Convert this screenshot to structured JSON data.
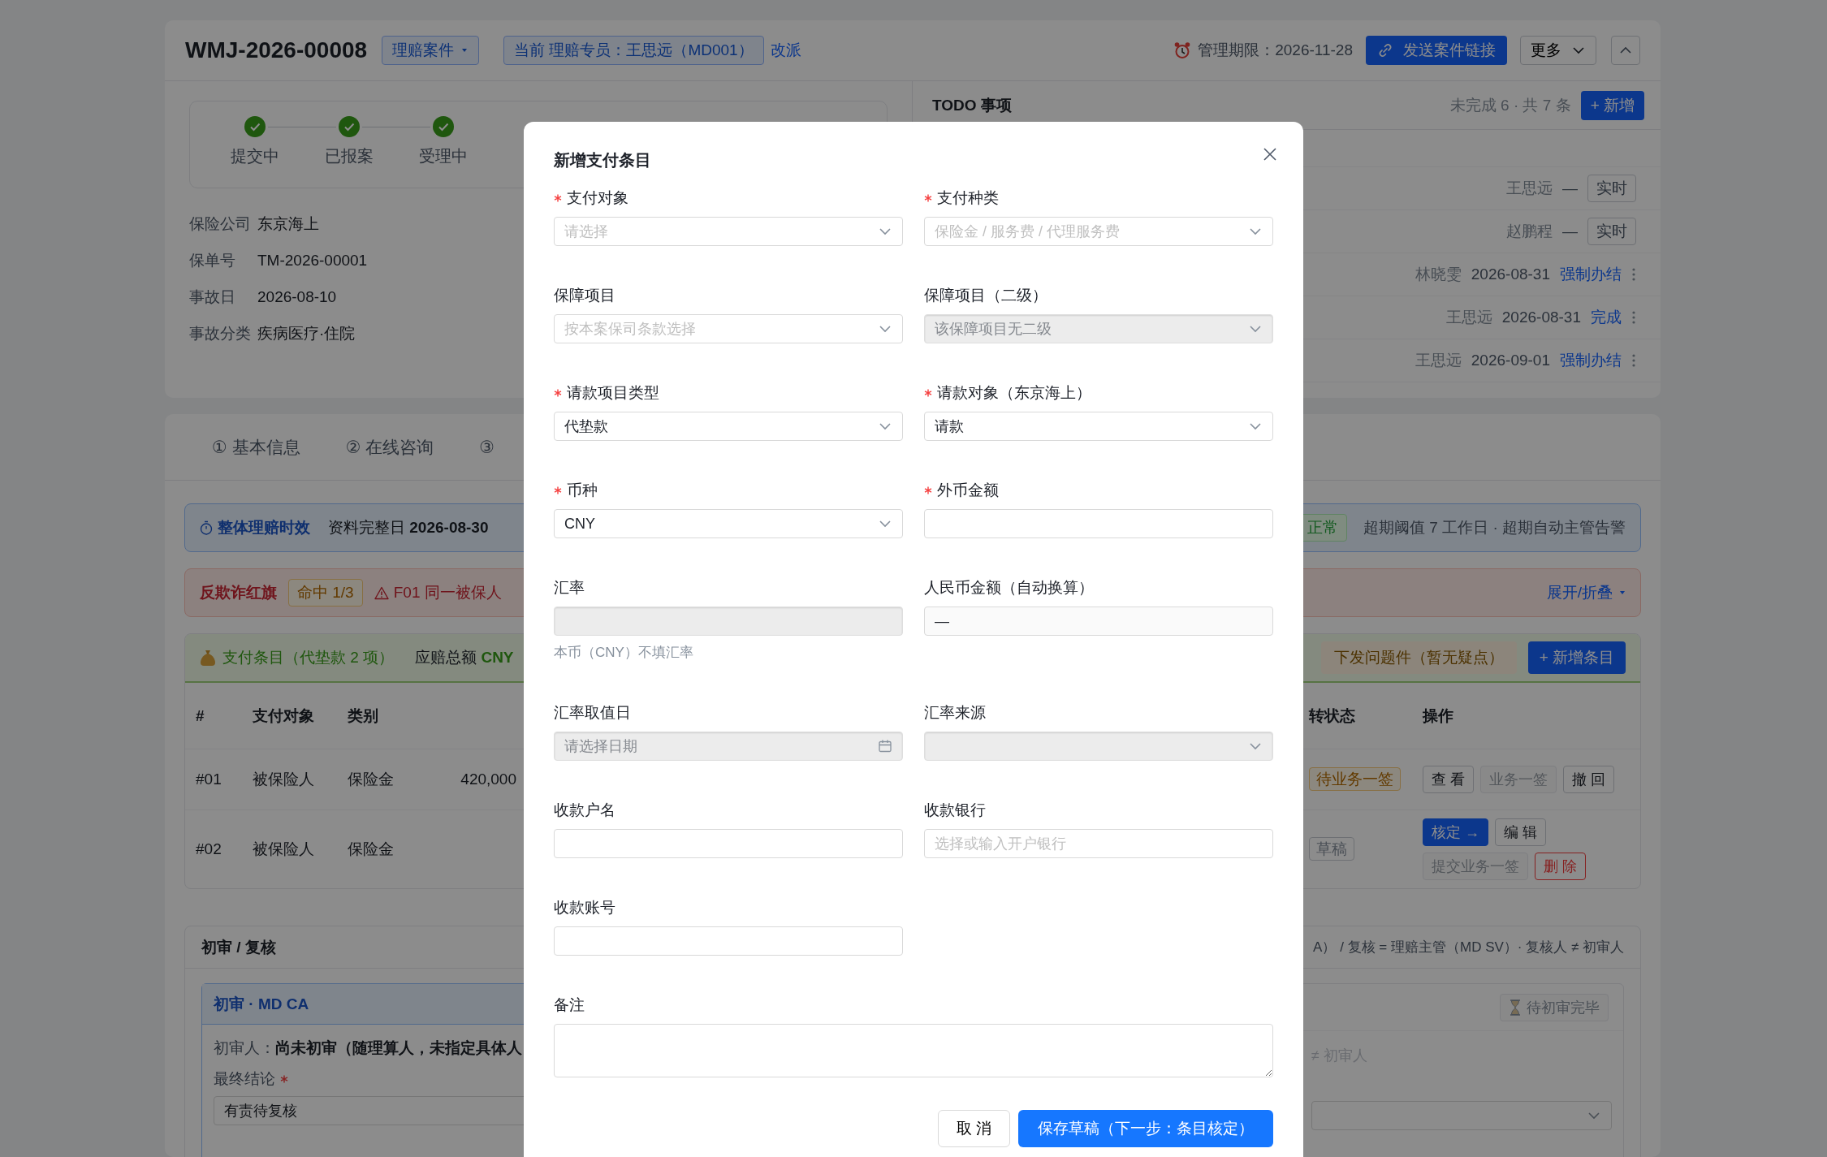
{
  "header": {
    "case_no": "WMJ-2026-00008",
    "case_type": "理赔案件",
    "assignee": "当前 理赔专员：王思远（MD001）",
    "reassign_link": "改派",
    "deadline": "管理期限：2026-11-28",
    "send_link_button": "发送案件链接",
    "more_button": "更多"
  },
  "progress_steps": [
    {
      "label": "提交中",
      "kind": "done"
    },
    {
      "label": "已报案",
      "kind": "done"
    },
    {
      "label": "受理中",
      "kind": "done"
    }
  ],
  "case_info": [
    {
      "label": "保险公司",
      "value": "东京海上"
    },
    {
      "label": "保单号",
      "value": "TM-2026-00001"
    },
    {
      "label": "事故日",
      "value": "2026-08-10"
    },
    {
      "label": "事故分类",
      "value": "疾病医疗·住院"
    }
  ],
  "todo": {
    "title": "TODO 事项",
    "summary": "未完成 6 · 共 7 条",
    "add_button": "+ 新增",
    "items": [
      {
        "assignee": "王思远",
        "due": "—",
        "action": "实时",
        "kind": "tag"
      },
      {
        "assignee": "赵鹏程",
        "due": "—",
        "action": "实时",
        "kind": "tag"
      },
      {
        "assignee": "林晓雯",
        "due": "2026-08-31",
        "action": "强制办结",
        "kind": "link"
      },
      {
        "assignee": "王思远",
        "due": "2026-08-31",
        "action": "完成",
        "kind": "link"
      },
      {
        "assignee": "王思远",
        "due": "2026-09-01",
        "action": "强制办结",
        "kind": "link"
      }
    ]
  },
  "tabs": [
    {
      "label": "① 基本信息",
      "selected": false
    },
    {
      "label": "② 在线咨询",
      "selected": false
    },
    {
      "label": "③",
      "selected": false
    }
  ],
  "sla_banner": {
    "title": "整体理赔时效",
    "complete_date": "资料完整日 **2026-08-30**",
    "status": "正常",
    "note": "超期阈值 7 工作日 · 超期自动主管告警"
  },
  "fraud_banner": {
    "title": "反欺诈红旗",
    "hits": "命中 1/3",
    "first_flag": "F01 同一被保人",
    "toggle": "展开/折叠"
  },
  "payments": {
    "title": "支付条目（代垫款 2 项）",
    "total": "应赔总额 **CNY**",
    "issue_button": "下发问题件（暂无疑点）",
    "add_button": "+ 新增条目",
    "columns": [
      "#",
      "支付对象",
      "类别",
      "转状态",
      "操作"
    ],
    "rows": [
      {
        "no": "#01",
        "payee": "被保险人",
        "category": "保险金",
        "amount": "420,000",
        "status": "待业务一签",
        "kind": "pending",
        "actions": [
          {
            "label": "查 看",
            "kind": "default"
          },
          {
            "label": "业务一签",
            "kind": "disabled"
          },
          {
            "label": "撤 回",
            "kind": "default"
          }
        ]
      },
      {
        "no": "#02",
        "payee": "被保险人",
        "category": "保险金",
        "status": "草稿",
        "kind": "draft",
        "actions": [
          {
            "label": "核定 →",
            "kind": "primary"
          },
          {
            "label": "编 辑",
            "kind": "default"
          },
          {
            "label": "提交业务一签",
            "kind": "disabled"
          },
          {
            "label": "删 除",
            "kind": "danger"
          }
        ]
      }
    ]
  },
  "review": {
    "title": "初审 / 复核",
    "rule": "A） / 复核 = 理赔主管（MD SV）· 复核人 ≠ 初审人",
    "first_review": {
      "title": "初审 · MD CA",
      "reviewer": "初审人：**尚未初审（随理算人，未指定具体人**",
      "conclusion_label": "最终结论",
      "conclusion_required": true,
      "conclusion": "有责待复核"
    },
    "second_review": {
      "status_button": "待初审完毕",
      "note": "≠ 初审人"
    }
  },
  "modal": {
    "title": "新增支付条目",
    "cancel_button": "取 消",
    "save_button": "保存草稿（下一步：条目核定）",
    "fields": [
      {
        "label": "支付对象",
        "required": true,
        "kind": "select",
        "placeholder": "请选择",
        "disabled": false
      },
      {
        "label": "支付种类",
        "required": true,
        "kind": "select",
        "placeholder": "保险金 / 服务费 / 代理服务费",
        "disabled": false
      },
      {
        "label": "保障项目",
        "required": false,
        "kind": "select",
        "placeholder": "按本案保司条款选择",
        "disabled": false
      },
      {
        "label": "保障项目（二级）",
        "required": false,
        "kind": "select",
        "placeholder": "该保障项目无二级",
        "disabled": true
      },
      {
        "label": "请款项目类型",
        "required": true,
        "kind": "select",
        "value": "代垫款",
        "disabled": false
      },
      {
        "label": "请款对象（东京海上）",
        "required": true,
        "kind": "select",
        "value": "请款",
        "disabled": false
      },
      {
        "label": "币种",
        "required": true,
        "kind": "select",
        "value": "CNY",
        "disabled": false
      },
      {
        "label": "外币金额",
        "required": true,
        "kind": "input",
        "disabled": false
      },
      {
        "label": "汇率",
        "required": false,
        "kind": "input",
        "disabled": true,
        "hint": "本币（CNY）不填汇率"
      },
      {
        "label": "人民币金额（自动换算）",
        "required": false,
        "kind": "input",
        "value": "—",
        "disabled": false,
        "readonly": true
      },
      {
        "label": "汇率取值日",
        "required": false,
        "kind": "date",
        "placeholder": "请选择日期",
        "disabled": true
      },
      {
        "label": "汇率来源",
        "required": false,
        "kind": "select",
        "disabled": true
      },
      {
        "label": "收款户名",
        "required": false,
        "kind": "input",
        "disabled": false
      },
      {
        "label": "收款银行",
        "required": false,
        "kind": "input",
        "placeholder": "选择或输入开户银行",
        "disabled": false
      },
      {
        "label": "收款账号",
        "required": false,
        "kind": "input",
        "disabled": false
      },
      {
        "label": "备注",
        "required": false,
        "kind": "textarea",
        "disabled": false
      }
    ]
  }
}
